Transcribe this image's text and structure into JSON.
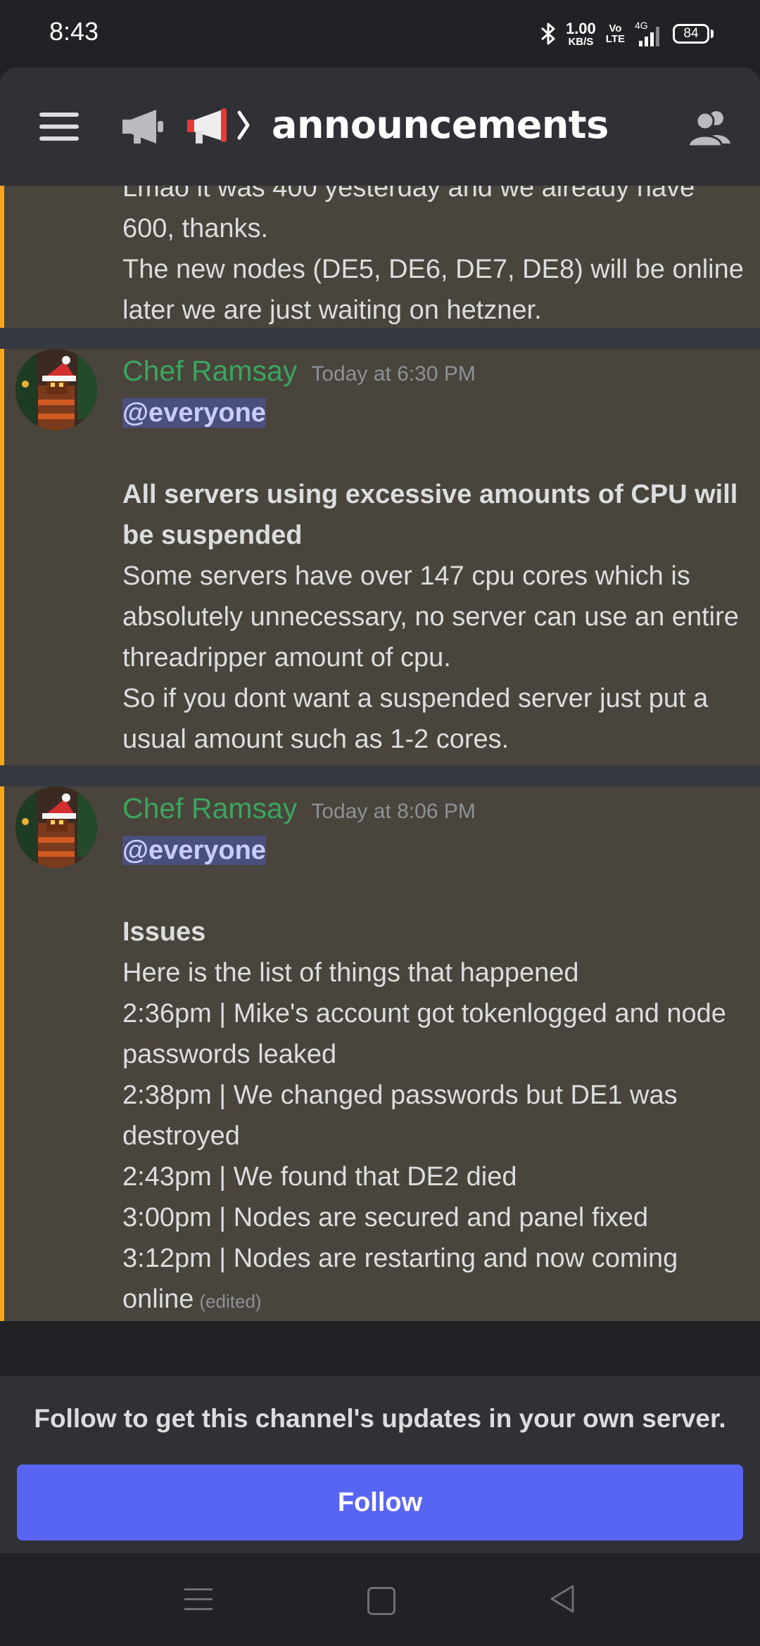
{
  "status_bar": {
    "time": "8:43",
    "speed_value": "1.00",
    "speed_unit": "KB/S",
    "volte_top": "Vo",
    "volte_bottom": "LTE",
    "network": "4G",
    "battery": "84"
  },
  "header": {
    "channel_name": "announcements",
    "icons": [
      "hamburger-icon",
      "megaphone-icon",
      "megaphone-icon",
      "members-icon"
    ]
  },
  "messages": [
    {
      "partial": true,
      "lines": [
        "Lmao it was 400 yesterday and we already have",
        "600, thanks.",
        "The new nodes (DE5, DE6, DE7, DE8) will be online later we are just waiting on hetzner."
      ]
    },
    {
      "author": "Chef Ramsay",
      "timestamp": "Today at 6:30 PM",
      "mention": "@everyone",
      "heading": "All servers using excessive amounts of CPU will be suspended",
      "lines": [
        "Some servers have over 147 cpu cores which is absolutely unnecessary, no server can use an entire threadripper amount of cpu.",
        "So if you dont want a suspended server just put a usual amount such as 1-2 cores."
      ]
    },
    {
      "author": "Chef Ramsay",
      "timestamp": "Today at 8:06 PM",
      "mention": "@everyone",
      "heading": "Issues",
      "lines": [
        "Here is the list of things that happened",
        "2:36pm | Mike's account got tokenlogged and node passwords leaked",
        "2:38pm | We changed passwords but DE1 was destroyed",
        "2:43pm | We found that DE2 died",
        "3:00pm | Nodes are secured and panel fixed",
        "3:12pm | Nodes are restarting and now coming online"
      ],
      "edited_label": "(edited)"
    }
  ],
  "follow": {
    "prompt": "Follow to get this channel's updates in your own server.",
    "button_label": "Follow"
  },
  "colors": {
    "accent": "#5865f2",
    "author": "#3ba55d",
    "highlight_stripe": "#faa61a",
    "message_bg": "#49443c"
  }
}
